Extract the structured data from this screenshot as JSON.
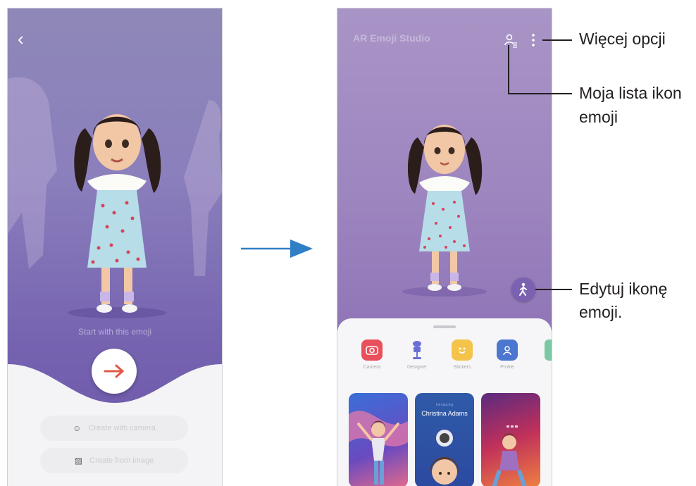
{
  "phone1": {
    "start_text": "Start with this emoji",
    "primary_options": [
      {
        "label": "Create with camera",
        "icon": "face-scan-icon"
      },
      {
        "label": "Create from image",
        "icon": "image-icon"
      }
    ],
    "next_button_color": "#e05848"
  },
  "phone2": {
    "title": "AR Emoji Studio",
    "modes": [
      {
        "label": "Camera",
        "icon": "camera-icon",
        "color": "#e8505b"
      },
      {
        "label": "Designer",
        "icon": "mannequin-icon",
        "color": "#6a6fd8"
      },
      {
        "label": "Stickers",
        "icon": "sticker-icon",
        "color": "#f4c44a"
      },
      {
        "label": "Profile",
        "icon": "profile-icon",
        "color": "#4c77d0"
      }
    ],
    "profile_card": {
      "subtitle": "Introducing",
      "name": "Christina Adams"
    }
  },
  "callouts": {
    "more_options": "Więcej opcji",
    "my_list_line1": "Moja lista ikon",
    "my_list_line2": "emoji",
    "edit_line1": "Edytuj ikonę",
    "edit_line2": "emoji."
  },
  "colors": {
    "accent_purple": "#7a62b0",
    "callout_text": "#231f20",
    "flow_arrow": "#2f7fc6"
  }
}
